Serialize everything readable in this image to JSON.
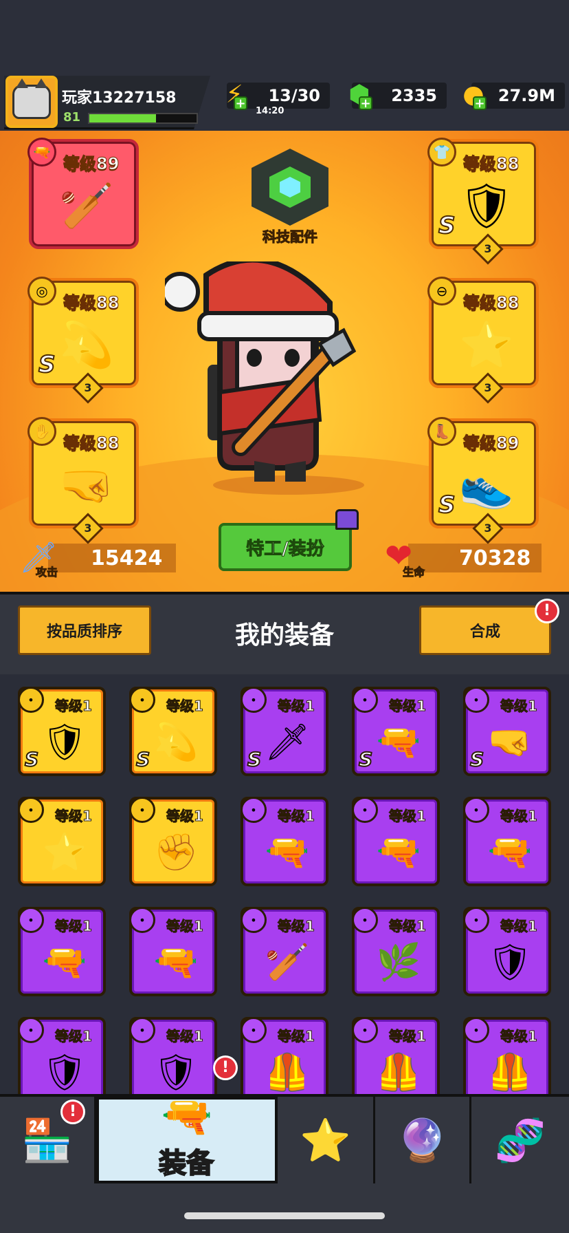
{
  "player": {
    "name": "玩家13227158",
    "level": "81",
    "xp_fraction": 0.62
  },
  "resources": {
    "energy": "13/30",
    "energy_timer": "14:20",
    "gems": "2335",
    "coins": "27.9M"
  },
  "tech_parts_label": "科技配件",
  "slots": {
    "weapon": {
      "level": "等级89",
      "icon": "weapon-icon"
    },
    "armor": {
      "level": "等级88",
      "grade": "S",
      "stars": "3"
    },
    "necklace": {
      "level": "等级88",
      "grade": "S",
      "stars": "3"
    },
    "belt": {
      "level": "等级88",
      "stars": "3"
    },
    "glove": {
      "level": "等级88",
      "stars": "3"
    },
    "boots": {
      "level": "等级89",
      "grade": "S",
      "stars": "3"
    }
  },
  "outfit_button": "特工/装扮",
  "stats": {
    "attack_label": "攻击",
    "attack_value": "15424",
    "life_label": "生命",
    "life_value": "70328"
  },
  "equip_header": {
    "sort_button": "按品质排序",
    "title": "我的装备",
    "merge_button": "合成",
    "alert": "!"
  },
  "inventory": [
    {
      "level": "等级1",
      "grade": "S",
      "rarity": "gold",
      "icon": "armor-icon"
    },
    {
      "level": "等级1",
      "grade": "S",
      "rarity": "gold",
      "icon": "necklace-icon"
    },
    {
      "level": "等级1",
      "grade": "S",
      "rarity": "purple",
      "icon": "sword-icon"
    },
    {
      "level": "等级1",
      "grade": "S",
      "rarity": "purple",
      "icon": "blaster-icon"
    },
    {
      "level": "等级1",
      "grade": "S",
      "rarity": "purple",
      "icon": "gauntlet-icon"
    },
    {
      "level": "等级1",
      "grade": "",
      "rarity": "gold",
      "icon": "belt-icon"
    },
    {
      "level": "等级1",
      "grade": "",
      "rarity": "gold",
      "icon": "glove-icon"
    },
    {
      "level": "等级1",
      "grade": "",
      "rarity": "purple",
      "icon": "revolver-icon"
    },
    {
      "level": "等级1",
      "grade": "",
      "rarity": "purple",
      "icon": "revolver-icon"
    },
    {
      "level": "等级1",
      "grade": "",
      "rarity": "purple",
      "icon": "revolver-icon"
    },
    {
      "level": "等级1",
      "grade": "",
      "rarity": "purple",
      "icon": "shotgun-icon"
    },
    {
      "level": "等级1",
      "grade": "",
      "rarity": "purple",
      "icon": "shotgun-icon"
    },
    {
      "level": "等级1",
      "grade": "",
      "rarity": "purple",
      "icon": "bat-icon"
    },
    {
      "level": "等级1",
      "grade": "",
      "rarity": "purple",
      "icon": "leaf-armor-icon"
    },
    {
      "level": "等级1",
      "grade": "",
      "rarity": "purple",
      "icon": "armor-icon"
    },
    {
      "level": "等级1",
      "grade": "",
      "rarity": "purple",
      "icon": "armor-icon"
    },
    {
      "level": "等级1",
      "grade": "",
      "rarity": "purple",
      "icon": "armor-icon"
    },
    {
      "level": "等级1",
      "grade": "",
      "rarity": "purple",
      "icon": "vest-icon"
    },
    {
      "level": "等级1",
      "grade": "",
      "rarity": "purple",
      "icon": "vest-icon"
    },
    {
      "level": "等级1",
      "grade": "",
      "rarity": "purple",
      "icon": "vest-icon"
    }
  ],
  "nav": {
    "equip_label": "装备",
    "alert": "!"
  }
}
